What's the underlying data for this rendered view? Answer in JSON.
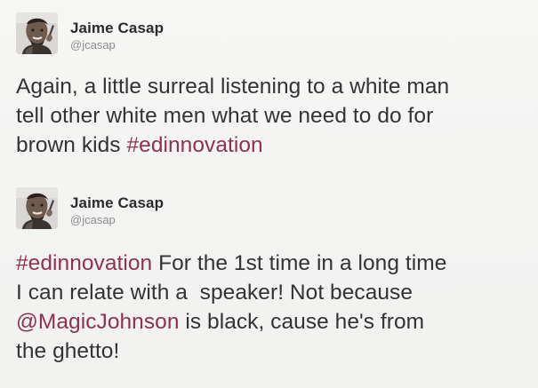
{
  "tweets": [
    {
      "author": {
        "name": "Jaime Casap",
        "handle": "@jcasap"
      },
      "lines": [
        [
          {
            "text": "Again, a little surreal listening to a white man",
            "type": "text"
          }
        ],
        [
          {
            "text": "tell other white men what we need to do for",
            "type": "text"
          }
        ],
        [
          {
            "text": "brown kids ",
            "type": "text"
          },
          {
            "text": "#edinnovation",
            "type": "hashtag"
          }
        ]
      ]
    },
    {
      "author": {
        "name": "Jaime Casap",
        "handle": "@jcasap"
      },
      "lines": [
        [
          {
            "text": "#edinnovation",
            "type": "hashtag"
          },
          {
            "text": " For the 1st time in a long time",
            "type": "text"
          }
        ],
        [
          {
            "text": "I can relate with a  speaker! Not because",
            "type": "text"
          }
        ],
        [
          {
            "text": "@MagicJohnson",
            "type": "mention"
          },
          {
            "text": " is black, cause he's from",
            "type": "text"
          }
        ],
        [
          {
            "text": "the ghetto!",
            "type": "text"
          }
        ]
      ]
    }
  ],
  "colors": {
    "background": "#f4f4f3",
    "text": "#333333",
    "name": "#2c2c2c",
    "handle": "#8d8d8d",
    "link": "#8f3152"
  },
  "icons": {
    "avatar": "profile-photo"
  }
}
